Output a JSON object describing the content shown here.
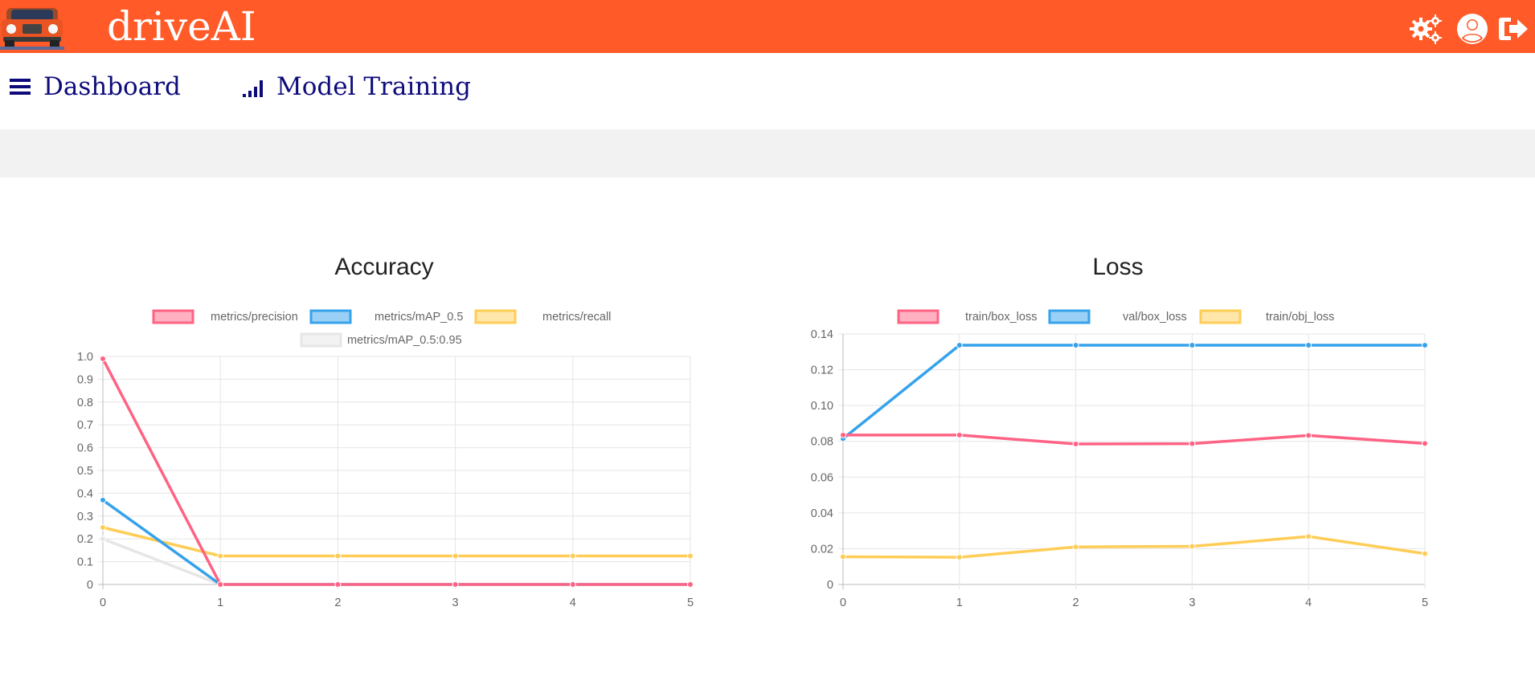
{
  "header": {
    "brand": "driveAI",
    "icons": [
      "car-logo-icon",
      "gears-icon",
      "user-circle-icon",
      "sign-out-icon"
    ],
    "background": "#ff5a27"
  },
  "nav": {
    "items": [
      {
        "label": "Dashboard",
        "icon": "hamburger-menu-icon"
      },
      {
        "label": "Model Training",
        "icon": "signal-bars-icon"
      }
    ]
  },
  "chart_data": [
    {
      "type": "line",
      "title": "Accuracy",
      "x": [
        0,
        1,
        2,
        3,
        4,
        5
      ],
      "ylim": [
        0,
        1.0
      ],
      "yticks": [
        "0",
        "0.1",
        "0.2",
        "0.3",
        "0.4",
        "0.5",
        "0.6",
        "0.7",
        "0.8",
        "0.9",
        "1.0"
      ],
      "xticks": [
        "0",
        "1",
        "2",
        "3",
        "4",
        "5"
      ],
      "grid": true,
      "legend": "top",
      "series": [
        {
          "name": "metrics/precision",
          "color": "#ff6384",
          "fill": "#ffb1c1",
          "values": [
            0.99,
            0,
            0,
            0,
            0,
            0
          ]
        },
        {
          "name": "metrics/mAP_0.5",
          "color": "#36a2eb",
          "fill": "#9ad0f5",
          "values": [
            0.37,
            0,
            0,
            0,
            0,
            0
          ]
        },
        {
          "name": "metrics/recall",
          "color": "#ffcd56",
          "fill": "#ffe6aa",
          "values": [
            0.25,
            0.125,
            0.125,
            0.125,
            0.125,
            0.125
          ]
        },
        {
          "name": "metrics/mAP_0.5:0.95",
          "color": "#e6e6e6",
          "fill": "#f2f2f2",
          "values": [
            0.2,
            0,
            0,
            0,
            0,
            0
          ]
        }
      ]
    },
    {
      "type": "line",
      "title": "Loss",
      "x": [
        0,
        1,
        2,
        3,
        4,
        5
      ],
      "ylim": [
        0,
        0.14
      ],
      "yticks": [
        "0",
        "0.02",
        "0.04",
        "0.06",
        "0.08",
        "0.10",
        "0.12",
        "0.14"
      ],
      "xticks": [
        "0",
        "1",
        "2",
        "3",
        "4",
        "5"
      ],
      "grid": true,
      "legend": "top",
      "series": [
        {
          "name": "train/box_loss",
          "color": "#ff6384",
          "fill": "#ffb1c1",
          "values": [
            0.0835,
            0.0835,
            0.0785,
            0.0787,
            0.0833,
            0.0788
          ]
        },
        {
          "name": "val/box_loss",
          "color": "#36a2eb",
          "fill": "#9ad0f5",
          "values": [
            0.0815,
            0.1337,
            0.1337,
            0.1337,
            0.1337,
            0.1337
          ]
        },
        {
          "name": "train/obj_loss",
          "color": "#ffcd56",
          "fill": "#ffe6aa",
          "values": [
            0.0155,
            0.0152,
            0.021,
            0.0213,
            0.0268,
            0.0172
          ]
        }
      ]
    }
  ]
}
